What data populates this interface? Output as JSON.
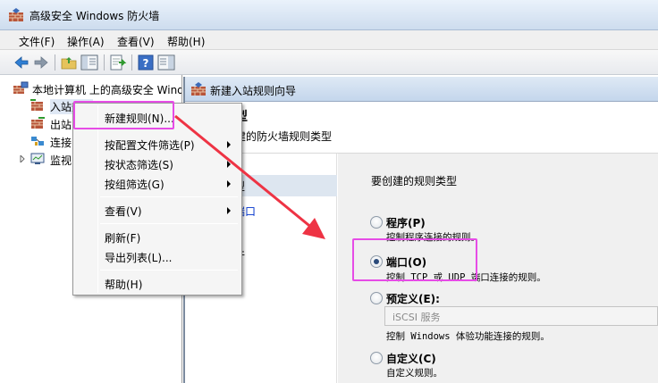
{
  "window": {
    "title": "高级安全 Windows 防火墙"
  },
  "menu": [
    "文件(F)",
    "操作(A)",
    "查看(V)",
    "帮助(H)"
  ],
  "toolbar": {
    "icons": [
      "back-icon",
      "forward-icon",
      "up-folder-icon",
      "show-hide-tree-icon",
      "export-icon",
      "help-icon",
      "show-hide-action-pane-icon"
    ]
  },
  "tree": {
    "root": "本地计算机 上的高级安全 Windo",
    "items": [
      "入站规则",
      "出站",
      "连接",
      "监视"
    ]
  },
  "wizard": {
    "title": "新建入站规则向导",
    "heading": "型",
    "subheading": "建的防火墙规则类型",
    "steps": [
      "型",
      "端口",
      "件"
    ],
    "question": "要创建的规则类型",
    "options": [
      {
        "label": "程序(P)",
        "desc": "控制程序连接的规则。",
        "checked": false
      },
      {
        "label": "端口(O)",
        "desc": "控制 TCP 或 UDP 端口连接的规则。",
        "checked": true
      },
      {
        "label": "预定义(E):",
        "desc": "控制 Windows 体验功能连接的规则。",
        "checked": false,
        "combo": "iSCSI 服务"
      },
      {
        "label": "自定义(C)",
        "desc": "自定义规则。",
        "checked": false
      }
    ]
  },
  "context_menu": {
    "items": [
      "新建规则(N)...",
      "按配置文件筛选(P)",
      "按状态筛选(S)",
      "按组筛选(G)",
      "查看(V)",
      "刷新(F)",
      "导出列表(L)...",
      "帮助(H)"
    ]
  },
  "colors": {
    "highlight": "#e64ce6",
    "arrow": "#ee3344",
    "link": "#0033cc"
  }
}
